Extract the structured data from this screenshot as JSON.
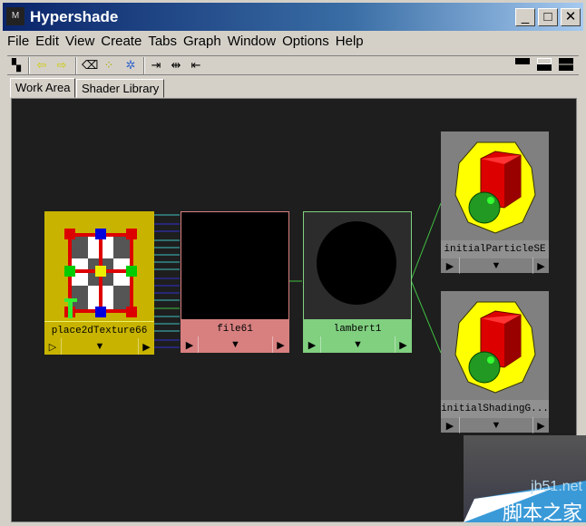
{
  "window": {
    "title": "Hypershade",
    "logo": "Maya"
  },
  "menu": [
    "File",
    "Edit",
    "View",
    "Create",
    "Tabs",
    "Graph",
    "Window",
    "Options",
    "Help"
  ],
  "tabs": [
    "Work Area",
    "Shader Library"
  ],
  "nodes": {
    "place2d": {
      "label": "place2dTexture66",
      "color": "#c8b400"
    },
    "file": {
      "label": "file61",
      "color": "#d88080"
    },
    "lambert": {
      "label": "lambert1",
      "color": "#80d080"
    },
    "particle": {
      "label": "initialParticleSE",
      "color": "#808080"
    },
    "shading": {
      "label": "initialShadingG...",
      "color": "#808080"
    }
  },
  "watermark": {
    "site": "jb51.net",
    "name": "脚本之家"
  }
}
